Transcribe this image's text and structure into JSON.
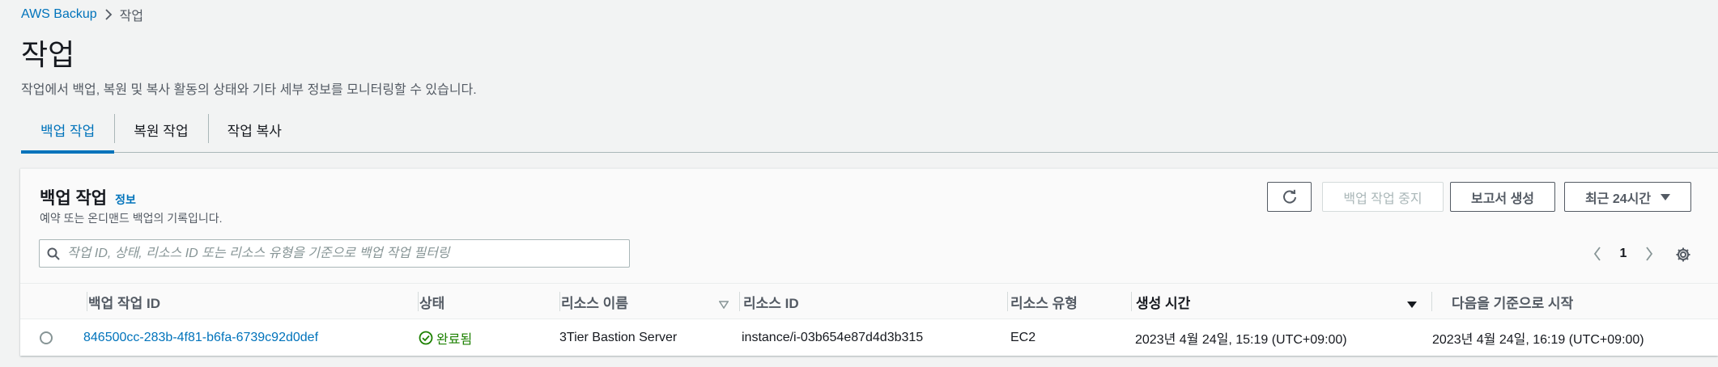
{
  "breadcrumb": {
    "root": "AWS Backup",
    "current": "작업"
  },
  "page": {
    "title": "작업",
    "description": "작업에서 백업, 복원 및 복사 활동의 상태와 기타 세부 정보를 모니터링할 수 있습니다."
  },
  "tabs": [
    {
      "label": "백업 작업",
      "active": true
    },
    {
      "label": "복원 작업",
      "active": false
    },
    {
      "label": "작업 복사",
      "active": false
    }
  ],
  "panel": {
    "title": "백업 작업",
    "info_link": "정보",
    "description": "예약 또는 온디맨드 백업의 기록입니다.",
    "buttons": {
      "stop": "백업 작업 중지",
      "report": "보고서 생성",
      "range": "최근 24시간"
    },
    "search": {
      "placeholder": "작업 ID, 상태, 리소스 ID 또는 리소스 유형을 기준으로 백업 작업 필터링",
      "value": ""
    },
    "pagination": {
      "current_page": "1"
    }
  },
  "table": {
    "columns": {
      "job_id": "백업 작업 ID",
      "status": "상태",
      "resource_name": "리소스 이름",
      "resource_id": "리소스 ID",
      "resource_type": "리소스 유형",
      "created": "생성 시간",
      "start_by": "다음을 기준으로 시작"
    },
    "rows": [
      {
        "job_id": "846500cc-283b-4f81-b6fa-6739c92d0def",
        "status": "완료됨",
        "resource_name": "3Tier Bastion Server",
        "resource_id": "instance/i-03b654e87d4d3b315",
        "resource_type": "EC2",
        "created": "2023년 4월 24일, 15:19 (UTC+09:00)",
        "start_by": "2023년 4월 24일, 16:19 (UTC+09:00)"
      }
    ]
  },
  "colors": {
    "link": "#0073bb",
    "success": "#1d8102",
    "text": "#16191f",
    "muted": "#545b64",
    "background": "#f2f3f3"
  },
  "icons": [
    "chevron-right-icon",
    "refresh-icon",
    "caret-down-icon",
    "search-icon",
    "chevron-left-icon",
    "gear-icon",
    "sort-caret-icon",
    "status-success-icon"
  ]
}
